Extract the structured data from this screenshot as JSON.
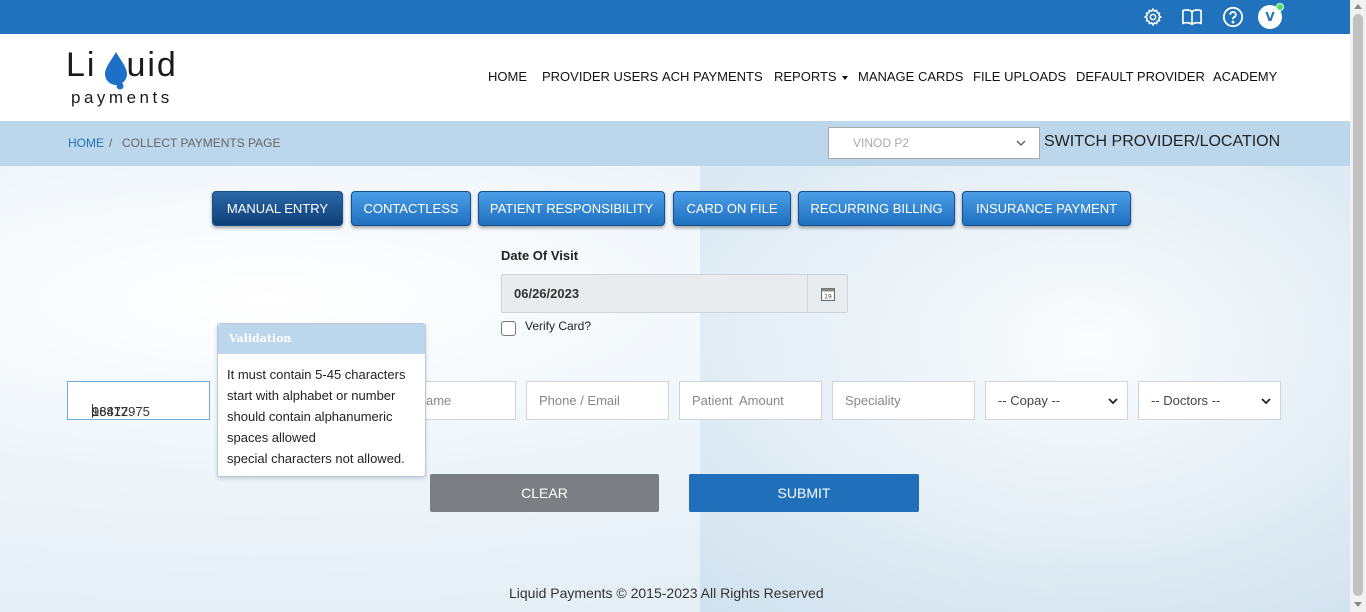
{
  "topbar": {
    "avatar_initial": "V",
    "icons": [
      "gear-icon",
      "book-icon",
      "help-icon"
    ]
  },
  "logo": {
    "word_left": "Li",
    "word_right": "uid",
    "sub": "payments"
  },
  "nav": {
    "home": "HOME",
    "provider_users": "PROVIDER USERS",
    "ach_payments": "ACH PAYMENTS",
    "reports": "REPORTS",
    "manage_cards": "MANAGE CARDS",
    "file_uploads": "FILE UPLOADS",
    "default_provider": "DEFAULT PROVIDER",
    "academy": "ACADEMY"
  },
  "breadcrumb": {
    "home": "HOME",
    "sep": "/",
    "page": "COLLECT PAYMENTS PAGE"
  },
  "provider": {
    "selected": "VINOD P2",
    "switch_label": "SWITCH PROVIDER/LOCATION"
  },
  "tabs": {
    "manual_entry": "MANUAL ENTRY",
    "contactless": "CONTACTLESS",
    "patient_responsibility": "PATIENT RESPONSIBILITY",
    "card_on_file": "CARD ON FILE",
    "recurring_billing": "RECURRING BILLING",
    "insurance_payment": "INSURANCE PAYMENT"
  },
  "form": {
    "date_label": "Date Of Visit",
    "date_value": "06/26/2023",
    "verify_label": "Verify Card?",
    "account_value": "16877975",
    "account_value_rest": "98412",
    "name_placeholder_tail": "ame",
    "phone_placeholder": "Phone / Email",
    "amount_placeholder": "Patient  Amount",
    "speciality_placeholder": "Speciality",
    "copay_selected": "-- Copay --",
    "doctors_selected": "-- Doctors --"
  },
  "tooltip": {
    "title": "Validation",
    "lines": [
      "It must contain 5-45 characters",
      "start with alphabet or number",
      "should contain alphanumeric",
      "spaces allowed",
      "special characters not allowed."
    ]
  },
  "buttons": {
    "clear": "CLEAR",
    "submit": "SUBMIT"
  },
  "footer": {
    "text": "Liquid Payments © 2015-2023 All Rights Reserved"
  },
  "colors": {
    "topbar": "#1f72bb",
    "crumbbar": "#bcd6ec",
    "submit": "#1f6fba",
    "clear": "#7b7f83",
    "online_dot": "#3ee65a"
  }
}
